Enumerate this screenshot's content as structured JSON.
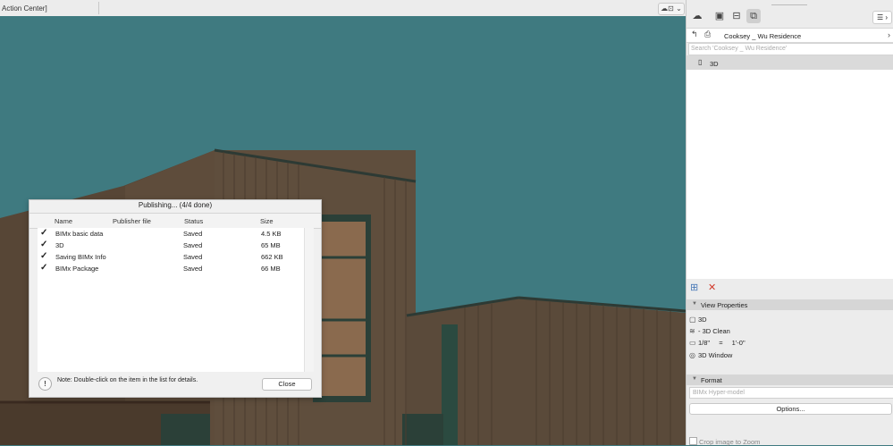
{
  "topbar": {
    "tab_title": "Action Center]",
    "camera_label": "☁⊡ ⌄"
  },
  "dialog": {
    "title": "Publishing... (4/4 done)",
    "columns": [
      "Name",
      "Publisher file",
      "Status",
      "Size"
    ],
    "rows": [
      {
        "name": "BIMx basic data",
        "status": "Saved",
        "size": "4.5 KB"
      },
      {
        "name": "3D",
        "status": "Saved",
        "size": "65 MB"
      },
      {
        "name": "Saving BIMx Info",
        "status": "Saved",
        "size": "662 KB"
      },
      {
        "name": "BIMx Package",
        "status": "Saved",
        "size": "66 MB"
      }
    ],
    "note_icon": "!",
    "note": "Note: Double-click on the item in the list for details.",
    "close_label": "Close"
  },
  "panel": {
    "project_name": "Cooksey _ Wu Residence",
    "search_placeholder": "Search 'Cooksey _ Wu Residence'",
    "tree_item": "3D",
    "view_properties_title": "View Properties",
    "props": {
      "view_name": "3D",
      "layer_combo": "- 3D Clean",
      "scale_left": "1/8\"",
      "scale_eq": "=",
      "scale_right": "1'-0\"",
      "window": "3D Window"
    },
    "format_title": "Format",
    "format_value": "BIMx Hyper-model",
    "options_label": "Options...",
    "crop_label": "Crop image to Zoom"
  },
  "colors": {
    "sky": "#3f7a80",
    "wall": "#5a4a3a",
    "trim": "#2d4a40",
    "check": "#2d9b3a",
    "delete": "#d23a2a"
  }
}
